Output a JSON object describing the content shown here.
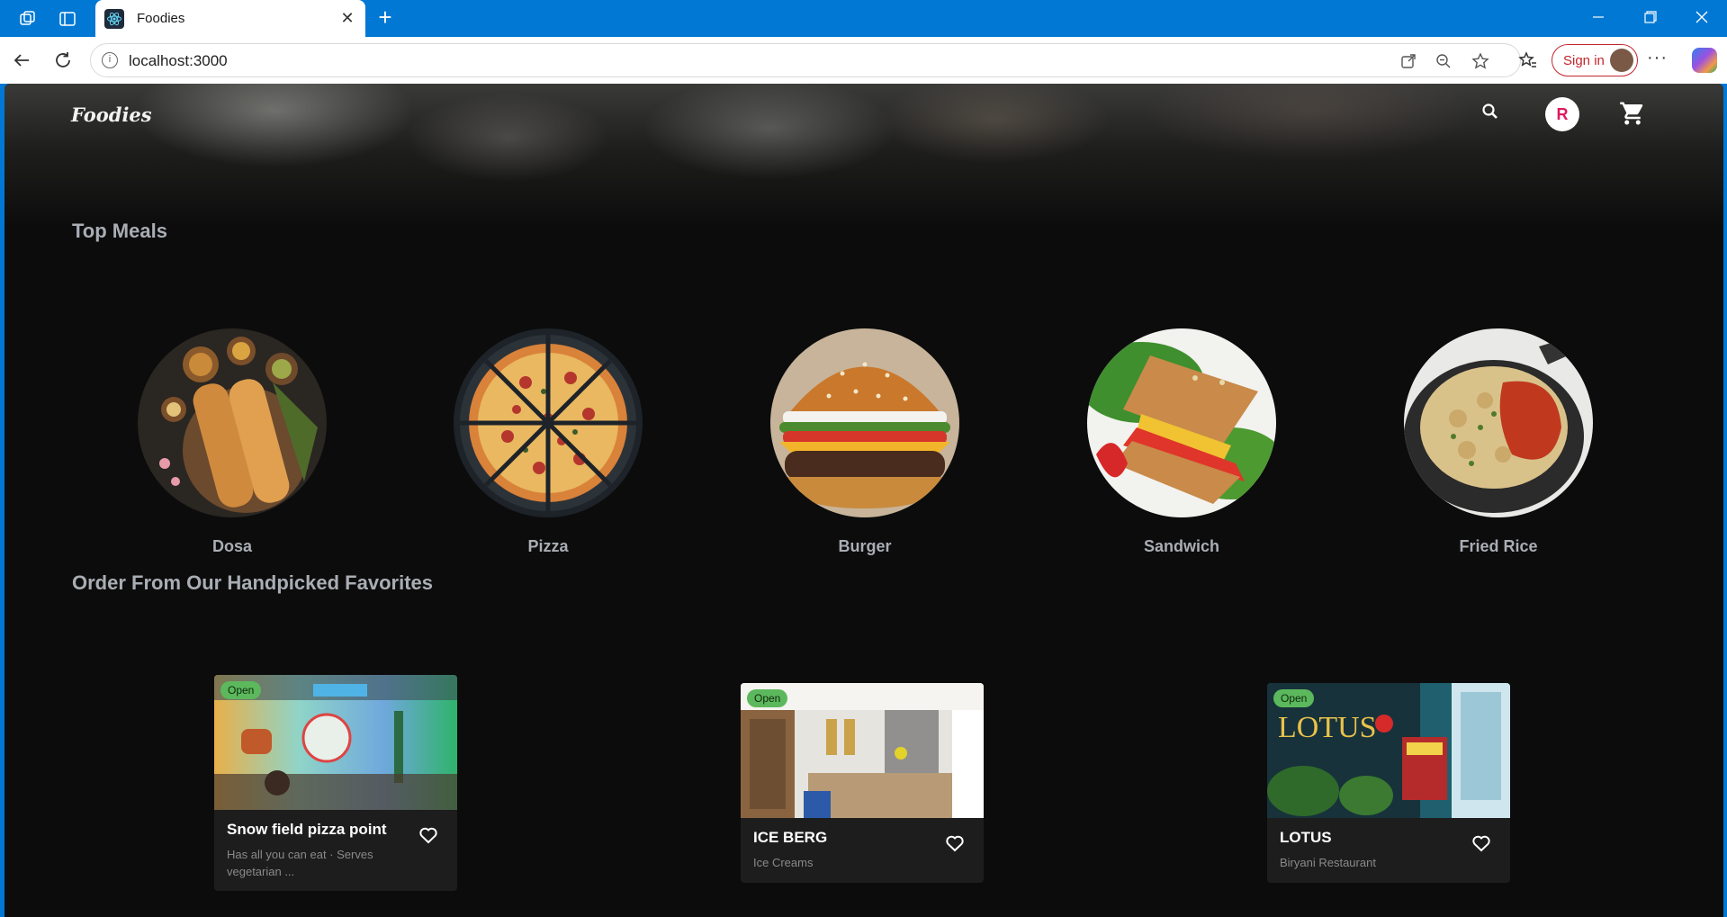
{
  "browser": {
    "tab_title": "Foodies",
    "tab_close": "✕",
    "new_tab": "+",
    "url": "localhost:3000",
    "sign_in": "Sign in",
    "more": "···"
  },
  "page": {
    "logo": "Foodies",
    "avatar_initial": "R",
    "top_meals_title": "Top Meals",
    "meals": [
      {
        "name": "Dosa"
      },
      {
        "name": "Pizza"
      },
      {
        "name": "Burger"
      },
      {
        "name": "Sandwich"
      },
      {
        "name": "Fried Rice"
      }
    ],
    "favorites_title": "Order From Our Handpicked Favorites",
    "restaurants": [
      {
        "status": "Open",
        "name": "Snow field pizza point",
        "desc": "Has all you can eat · Serves vegetarian ..."
      },
      {
        "status": "Open",
        "name": "ICE BERG",
        "desc": "Ice Creams"
      },
      {
        "status": "Open",
        "name": "LOTUS",
        "desc": "Biryani Restaurant"
      }
    ]
  }
}
